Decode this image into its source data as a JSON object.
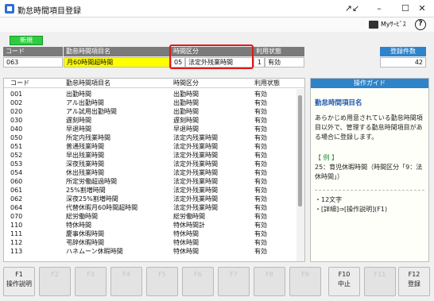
{
  "window": {
    "title": "勤怠時間項目登録",
    "expand_icon": "↗↙",
    "minimize_icon": "–",
    "maximize_icon": "☐",
    "close_icon": "✕"
  },
  "toolbar": {
    "myservice_label": "Myｻｰﾋﾞｽ",
    "help_icon": "?"
  },
  "header": {
    "new_badge": "新規",
    "code_label": "コード",
    "code_value": "063",
    "name_label": "勤怠時間項目名",
    "name_value": "月60時間超時間",
    "category_label": "時間区分",
    "category_code": "05",
    "category_value": "法定外残業時間",
    "usage_label": "利用状態",
    "usage_code": "1",
    "usage_value": "有効",
    "count_label": "登録件数",
    "count_value": "42"
  },
  "list": {
    "columns": [
      "コード",
      "勤怠時間項目名",
      "時間区分",
      "利用状態"
    ],
    "rows": [
      [
        "001",
        "出勤時間",
        "出勤時間",
        "有効"
      ],
      [
        "002",
        "アル出勤時間",
        "出勤時間",
        "有効"
      ],
      [
        "020",
        "アル試用出勤時間",
        "出勤時間",
        "有効"
      ],
      [
        "030",
        "遅刻時間",
        "遅刻時間",
        "有効"
      ],
      [
        "040",
        "早退時間",
        "早退時間",
        "有効"
      ],
      [
        "050",
        "所定内残業時間",
        "法定内残業時間",
        "有効"
      ],
      [
        "051",
        "普通残業時間",
        "法定外残業時間",
        "有効"
      ],
      [
        "052",
        "早出残業時間",
        "法定外残業時間",
        "有効"
      ],
      [
        "053",
        "深夜残業時間",
        "法定外残業時間",
        "有効"
      ],
      [
        "054",
        "休出残業時間",
        "法定外残業時間",
        "有効"
      ],
      [
        "060",
        "所定労働超過時間",
        "法定外残業時間",
        "有効"
      ],
      [
        "061",
        "25%割増時間",
        "法定外残業時間",
        "有効"
      ],
      [
        "062",
        "深夜25%割増時間",
        "法定外残業時間",
        "有効"
      ],
      [
        "064",
        "代替休暇月60時間超時間",
        "法定外残業時間",
        "有効"
      ],
      [
        "070",
        "総労働時間",
        "総労働時間",
        "有効"
      ],
      [
        "110",
        "特休時間",
        "特休時間計",
        "有効"
      ],
      [
        "111",
        "慶事休暇時間",
        "特休時間",
        "有効"
      ],
      [
        "112",
        "弔辞休暇時間",
        "特休時間",
        "有効"
      ],
      [
        "113",
        "ハネムーン休暇時間",
        "特休時間",
        "有効"
      ]
    ]
  },
  "guide": {
    "header": "操作ガイド",
    "title": "勤怠時間項目名",
    "body": "あらかじめ用意されている勤怠時間項目以外で、管理する勤怠時間項目がある場合に登録します。",
    "example_label": "【 例 】",
    "example_text": "25：育児休暇時間（時間区分「9：法休時間」）",
    "note_length": "・12文字",
    "note_link": "・[詳細]⇒[操作説明](F1)"
  },
  "fkeys": [
    {
      "key": "F1",
      "label": "操作説明",
      "enabled": true
    },
    {
      "key": "F2",
      "label": "",
      "enabled": false
    },
    {
      "key": "F3",
      "label": "",
      "enabled": false
    },
    {
      "key": "F4",
      "label": "",
      "enabled": false
    },
    {
      "key": "F5",
      "label": "",
      "enabled": false
    },
    {
      "key": "F6",
      "label": "",
      "enabled": false
    },
    {
      "key": "F7",
      "label": "",
      "enabled": false
    },
    {
      "key": "F8",
      "label": "",
      "enabled": false
    },
    {
      "key": "F9",
      "label": "",
      "enabled": false
    },
    {
      "key": "F10",
      "label": "中止",
      "enabled": true
    },
    {
      "key": "F11",
      "label": "",
      "enabled": false
    },
    {
      "key": "F12",
      "label": "登録",
      "enabled": true
    }
  ]
}
